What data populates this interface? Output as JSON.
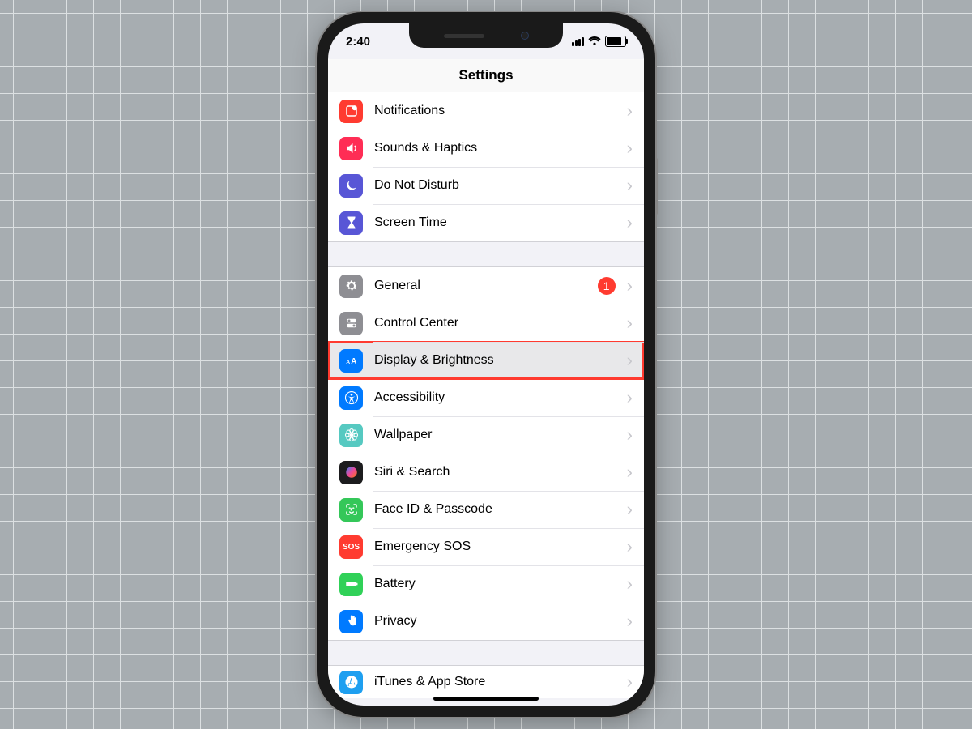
{
  "status_bar": {
    "time": "2:40"
  },
  "header": {
    "title": "Settings"
  },
  "group_a": [
    {
      "icon": "notifications-icon",
      "color": "c-red",
      "label": "Notifications"
    },
    {
      "icon": "sounds-icon",
      "color": "c-pink",
      "label": "Sounds & Haptics"
    },
    {
      "icon": "moon-icon",
      "color": "c-purple",
      "label": "Do Not Disturb"
    },
    {
      "icon": "hourglass-icon",
      "color": "c-purple",
      "label": "Screen Time"
    }
  ],
  "group_b": [
    {
      "icon": "gear-icon",
      "color": "c-grey",
      "label": "General",
      "badge": "1"
    },
    {
      "icon": "switches-icon",
      "color": "c-grey",
      "label": "Control Center"
    },
    {
      "icon": "text-size-icon",
      "color": "c-blue",
      "label": "Display & Brightness",
      "highlight": true
    },
    {
      "icon": "accessibility-icon",
      "color": "c-blue",
      "label": "Accessibility"
    },
    {
      "icon": "flower-icon",
      "color": "c-teal",
      "label": "Wallpaper"
    },
    {
      "icon": "siri-icon",
      "color": "c-black",
      "label": "Siri & Search"
    },
    {
      "icon": "faceid-icon",
      "color": "c-green",
      "label": "Face ID & Passcode"
    },
    {
      "icon": "sos-icon",
      "color": "c-red",
      "label": "Emergency SOS",
      "sos": "SOS"
    },
    {
      "icon": "battery-icon",
      "color": "c-green2",
      "label": "Battery"
    },
    {
      "icon": "hand-icon",
      "color": "c-blue",
      "label": "Privacy"
    }
  ],
  "group_c": [
    {
      "icon": "appstore-icon",
      "color": "c-sky",
      "label": "iTunes & App Store"
    }
  ],
  "chevron": "›"
}
